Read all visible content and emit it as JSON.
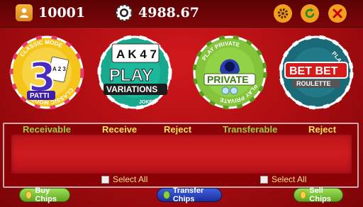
{
  "topbar": {
    "chips_count": "10001",
    "balance": "4988.67",
    "user_icon": "user-icon",
    "chip_icon": "poker-chip-icon",
    "settings_icon": "gear-icon",
    "refresh_icon": "refresh-icon",
    "close_icon": "close-icon"
  },
  "games": [
    {
      "id": "3patti",
      "ring_text": "CLASSIC MODE",
      "big": "3",
      "small": "PATTI",
      "cards": "A 2 3"
    },
    {
      "id": "play-variations",
      "cards": "A K 4 7",
      "line1": "PLAY",
      "line2": "VARIATIONS",
      "sub": "JOKER"
    },
    {
      "id": "private",
      "ring_text": "PLAY PRIVATE",
      "label": "PRIVATE"
    },
    {
      "id": "betbet",
      "ring_text": "PLAY",
      "line1": "BET BET",
      "line2": "ROULETTE"
    }
  ],
  "panel": {
    "headers": {
      "receivable": "Receivable",
      "receive": "Receive",
      "reject1": "Reject",
      "transferable": "Transferable",
      "reject2": "Reject"
    },
    "select_all_left": "Select All",
    "select_all_right": "Select All"
  },
  "buttons": {
    "buy": "Buy Chips",
    "transfer": "Transfer Chips",
    "sell": "Sell Chips"
  },
  "colors": {
    "header_green": "#9ccc45",
    "header_yellow": "#f6e35c",
    "buy_bg": "#7cc23a",
    "transfer_bg": "#2b48c8",
    "sell_bg": "#7cc23a"
  }
}
